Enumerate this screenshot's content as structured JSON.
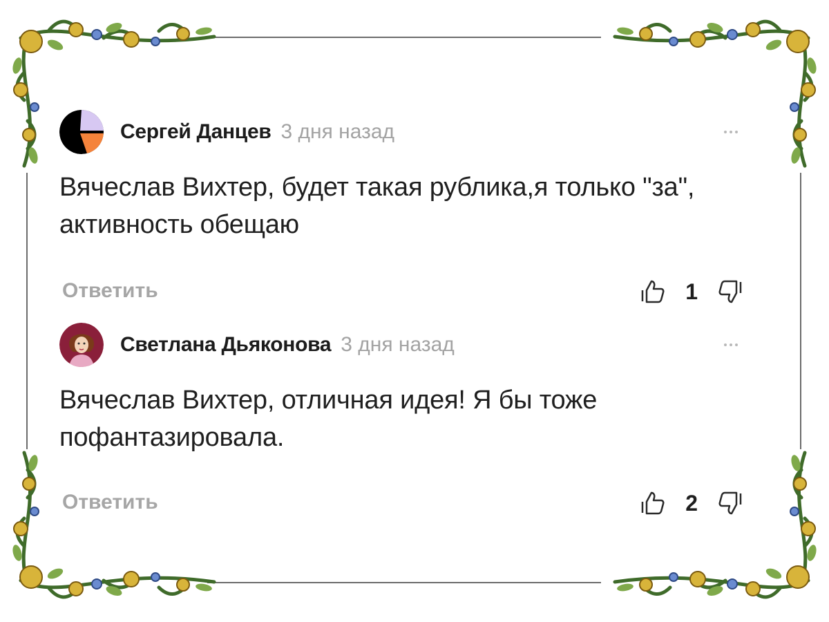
{
  "comments": [
    {
      "author": "Сергей Данцев",
      "time": "3 дня назад",
      "text": "Вячеслав Вихтер, будет такая рублика,я только \"за\", активность обещаю",
      "reply_label": "Ответить",
      "likes": "1",
      "avatar_icon": "abstract-orange-purple-avatar"
    },
    {
      "author": "Светлана Дьяконова",
      "time": "3 дня назад",
      "text": "Вячеслав Вихтер, отличная идея! Я бы тоже пофантазировала.",
      "reply_label": "Ответить",
      "likes": "2",
      "avatar_icon": "illustrated-woman-avatar"
    }
  ],
  "icons": {
    "more": "more-dots-icon",
    "like": "thumbs-up-icon",
    "dislike": "thumbs-down-icon"
  },
  "colors": {
    "frame_vine": "#3f6b2a",
    "frame_flower": "#d8b43a",
    "text_secondary": "#a3a3a3"
  }
}
